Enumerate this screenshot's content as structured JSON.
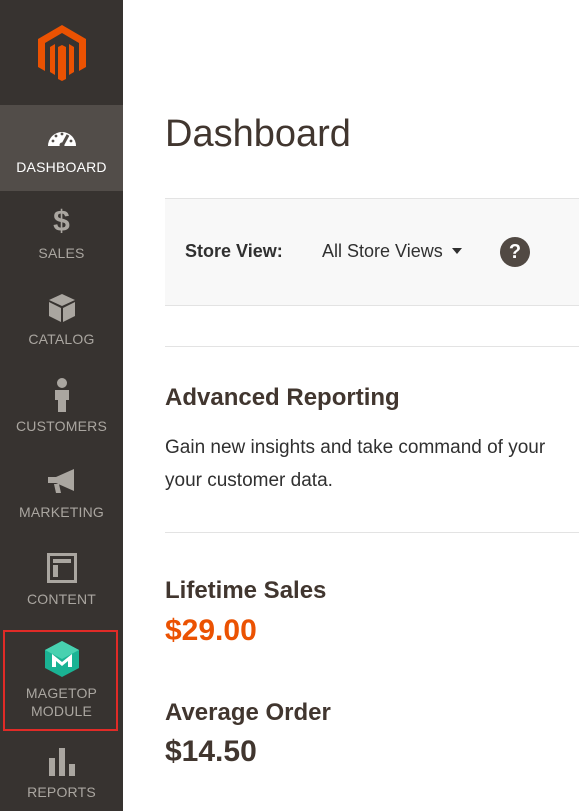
{
  "colors": {
    "sidebar_bg": "#373330",
    "sidebar_active_bg": "#524d49",
    "brand_orange": "#eb5202",
    "lifetime_sales": "#eb5202",
    "highlight_border": "#e02b27",
    "magetop_teal": "#1ab394"
  },
  "sidebar": {
    "logo_icon": "magento-logo-icon",
    "items": [
      {
        "label": "DASHBOARD",
        "icon": "speedometer-icon",
        "active": true
      },
      {
        "label": "SALES",
        "icon": "dollar-icon"
      },
      {
        "label": "CATALOG",
        "icon": "cube-icon"
      },
      {
        "label": "CUSTOMERS",
        "icon": "person-icon"
      },
      {
        "label": "MARKETING",
        "icon": "megaphone-icon"
      },
      {
        "label": "CONTENT",
        "icon": "layout-icon"
      },
      {
        "label_line1": "MAGETOP",
        "label_line2": "MODULE",
        "icon": "magetop-icon",
        "highlighted": true
      },
      {
        "label": "REPORTS",
        "icon": "bar-chart-icon"
      }
    ]
  },
  "main": {
    "title": "Dashboard",
    "store_view": {
      "label": "Store View:",
      "value": "All Store Views",
      "help": "?"
    },
    "advanced_reporting": {
      "title": "Advanced Reporting",
      "line1": "Gain new insights and take command of your",
      "line2": "your customer data."
    },
    "lifetime_sales": {
      "label": "Lifetime Sales",
      "value": "$29.00"
    },
    "average_order": {
      "label": "Average Order",
      "value": "$14.50"
    }
  }
}
